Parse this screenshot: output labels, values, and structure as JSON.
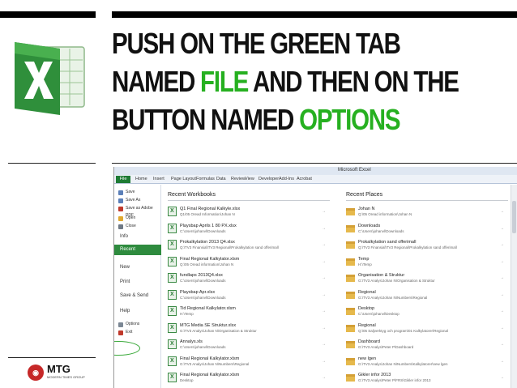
{
  "headline": {
    "line1": "PUSH ON THE GREEN TAB",
    "line2_pre": "NAMED ",
    "line2_green": "FILE",
    "line2_post": " AND THEN ON THE",
    "line3_pre": "BUTTON NAMED ",
    "line3_green": "OPTIONS"
  },
  "colors": {
    "accent_green": "#26b020",
    "excel_green": "#1e7b34",
    "bar": "#000000"
  },
  "logos": {
    "excel": "excel-logo-icon",
    "company": "MTG",
    "company_sub": "MODERN TIMES GROUP"
  },
  "excel": {
    "title": "Microsoft Excel",
    "file_tab": "File",
    "tabs": [
      "Home",
      "Insert",
      "Page Layout",
      "Formulas",
      "Data",
      "Review",
      "View",
      "Developer",
      "Add-Ins",
      "Acrobat"
    ],
    "backstage": {
      "items": [
        {
          "label": "Save",
          "icon": "save-icon",
          "small": true
        },
        {
          "label": "Save As",
          "icon": "save-as-icon",
          "small": true
        },
        {
          "label": "Save as Adobe PDF",
          "icon": "pdf-icon",
          "small": true
        },
        {
          "label": "Open",
          "icon": "open-folder-icon",
          "small": true
        },
        {
          "label": "Close",
          "icon": "close-file-icon",
          "small": true
        },
        {
          "label": "Info",
          "small": false
        },
        {
          "label": "Recent",
          "small": false,
          "selected": true
        },
        {
          "label": "New",
          "small": false
        },
        {
          "label": "Print",
          "small": false
        },
        {
          "label": "Save & Send",
          "small": false
        },
        {
          "label": "Help",
          "small": false
        },
        {
          "label": "Options",
          "icon": "options-icon",
          "small": true
        },
        {
          "label": "Exit",
          "icon": "exit-icon",
          "small": true
        }
      ]
    },
    "recent_workbooks": {
      "heading": "Recent Workbooks",
      "items": [
        {
          "name": "Q1 Final Regional Kalkyle.xlsx",
          "path": "Q1/05 Oread Information/Johan N"
        },
        {
          "name": "Playsbap Aprils 1 80 PX.xlsx",
          "path": "C:\\Users\\johanvl\\Downloads"
        },
        {
          "name": "Prokalkylation 2013 Q4.xlsx",
          "path": "Q:\\TV3 Finansial\\TV3 Regional\\Prokalkylation sand offerimall"
        },
        {
          "name": "Final Regional Kalkylator.xlsm",
          "path": "Q:\\05 Oread information\\Johan N"
        },
        {
          "name": "fundlaps 2013Q4.xlsx",
          "path": "C:\\Users\\johanvl\\Downloads"
        },
        {
          "name": "Playsbap Apr.xlsx",
          "path": "C:\\Users\\johanvl\\Downloads"
        },
        {
          "name": "Tid Regional Kalkylator.xlsm",
          "path": "H:\\Temp"
        },
        {
          "name": "MTG Media SE Struktur.xlsx",
          "path": "G:\\TV3 Analys\\Johan N\\Organisation & Struktur"
        },
        {
          "name": "Annalys.xls",
          "path": "C:\\Users\\johanvl\\Downloads"
        },
        {
          "name": "Final Regional Kalkylator.xlsm",
          "path": "G:\\TV3 Analys\\Johan N\\Numbers\\Regional"
        },
        {
          "name": "Final Regional Kalkylator.xlsm",
          "path": "Desktop"
        }
      ]
    },
    "recent_places": {
      "heading": "Recent Places",
      "items": [
        {
          "name": "Johan N",
          "path": "Q:\\05 Oread information\\Johan N"
        },
        {
          "name": "Downloads",
          "path": "C:\\Users\\johanvl\\Downloads"
        },
        {
          "name": "Prokalkylation sand offerimall",
          "path": "Q:\\TV3 Finansial\\TV3 Regional\\Prokalkylation sand offerimall"
        },
        {
          "name": "Temp",
          "path": "H:\\Temp"
        },
        {
          "name": "Organisation & Struktur",
          "path": "G:\\TV3 Analys\\Johan N\\Organisation & Struktur"
        },
        {
          "name": "Regional",
          "path": "G:\\TV3 Analys\\Johan N\\Numbers\\Regional"
        },
        {
          "name": "Desktop",
          "path": "C:\\Users\\johanvl\\Desktop"
        },
        {
          "name": "Regional",
          "path": "Q:\\05 Saljverktyg och program\\01 Kalkylatorer\\Regional"
        },
        {
          "name": "Dashboard",
          "path": "G:\\TV3 Analys\\Peter P\\Dashboard"
        },
        {
          "name": "new lgen",
          "path": "G:\\TV3 Analys\\Johan N\\Numbers\\Kalkylatorer\\new lgen"
        },
        {
          "name": "Gikler infor 2013",
          "path": "G:\\TV3 Analys\\Peter P\\FRS\\Gikler infor 2013"
        }
      ]
    }
  }
}
